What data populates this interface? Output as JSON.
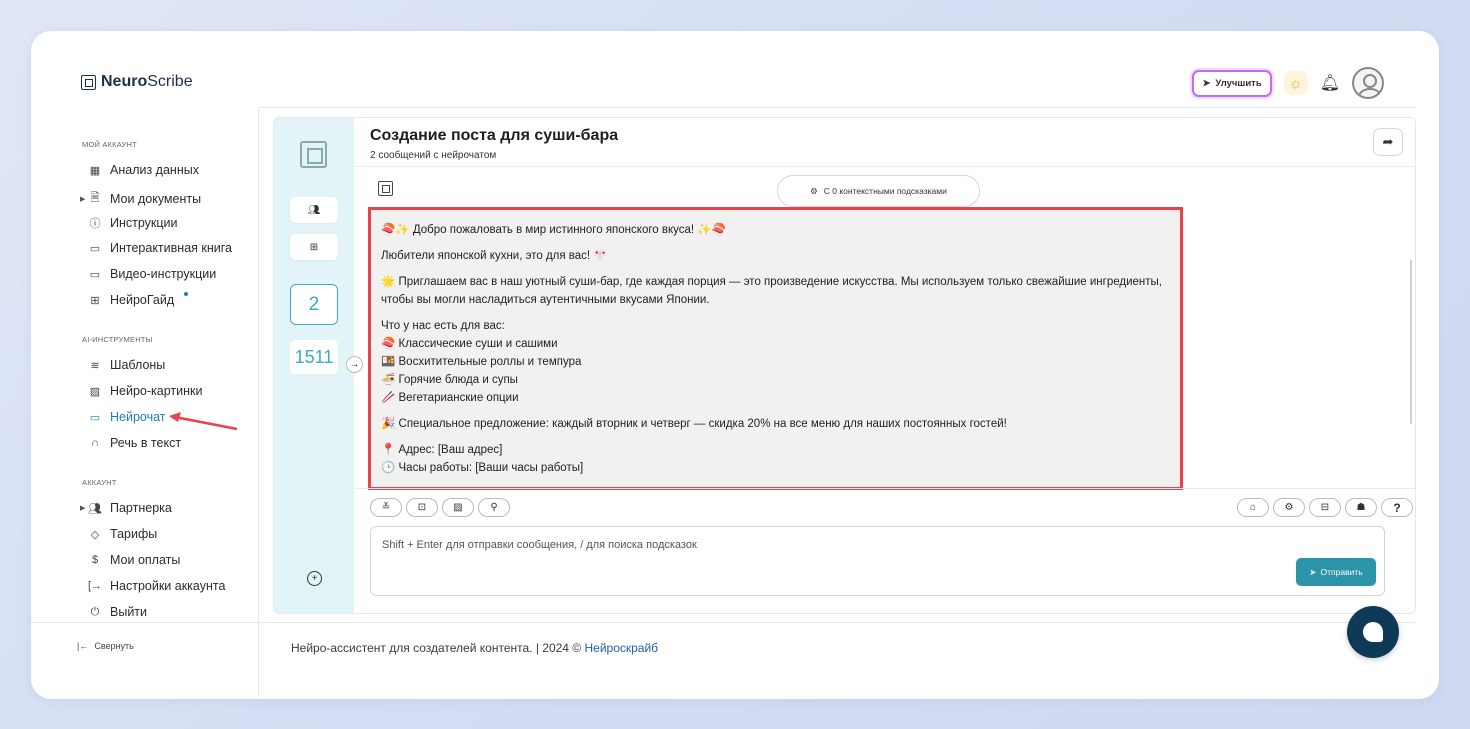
{
  "brand": {
    "name_bold": "Neuro",
    "name_light": "Scribe"
  },
  "header": {
    "upgrade_label": "Улучшить"
  },
  "sidebar": {
    "sections": [
      {
        "title": "МОЙ АККАУНТ"
      },
      {
        "title": "AI-ИНСТРУМЕНТЫ"
      },
      {
        "title": "АККАУНТ"
      }
    ],
    "items": [
      {
        "label": "Анализ данных"
      },
      {
        "label": "Мои документы"
      },
      {
        "label": "Инструкции"
      },
      {
        "label": "Интерактивная книга"
      },
      {
        "label": "Видео-инструкции"
      },
      {
        "label": "НейроГайд"
      },
      {
        "label": "Шаблоны"
      },
      {
        "label": "Нейро-картинки"
      },
      {
        "label": "Нейрочат"
      },
      {
        "label": "Речь в текст"
      },
      {
        "label": "Партнерка"
      },
      {
        "label": "Тарифы"
      },
      {
        "label": "Мои оплаты"
      },
      {
        "label": "Настройки аккаунта"
      },
      {
        "label": "Выйти"
      }
    ],
    "collapse_label": "Свернуть"
  },
  "rail": {
    "messages_count": "2",
    "tokens_count": "1511"
  },
  "chat": {
    "title": "Создание поста для суши-бара",
    "subtitle": "2 сообщений с нейрочатом",
    "hints_label": "С 0 контекстными подсказками",
    "message": {
      "line1": "🍣✨ Добро пожаловать в мир истинного японского вкуса! ✨🍣",
      "line2": "Любители японской кухни, это для вас! 🎌",
      "line3": "🌟 Приглашаем вас в наш уютный суши-бар, где каждая порция — это произведение искусства. Мы используем только свежайшие ингредиенты, чтобы вы могли насладиться аутентичными вкусами Японии.",
      "list_title": "Что у нас есть для вас:",
      "list": [
        "🍣 Классические суши и сашими",
        "🍱 Восхитительные роллы и темпура",
        "🍜 Горячие блюда и супы",
        "🥢 Вегетарианские опции"
      ],
      "offer": "🎉 Специальное предложение: каждый вторник и четверг — скидка 20% на все меню для наших постоянных гостей!",
      "address": "📍 Адрес: [Ваш адрес]",
      "hours_partial": "🕒 Часы работы: [Ваши часы работы]"
    },
    "input_placeholder": "Shift + Enter для отправки сообщения, / для поиска подсказок",
    "send_label": "Отправить"
  },
  "footer": {
    "text": "Нейро-ассистент для создателей контента.  | 2024 © ",
    "link": "Нейроскрайб"
  },
  "colors": {
    "accent": "#2b94a8",
    "highlight_border": "#e8424d",
    "active_nav": "#1a7fb0"
  }
}
